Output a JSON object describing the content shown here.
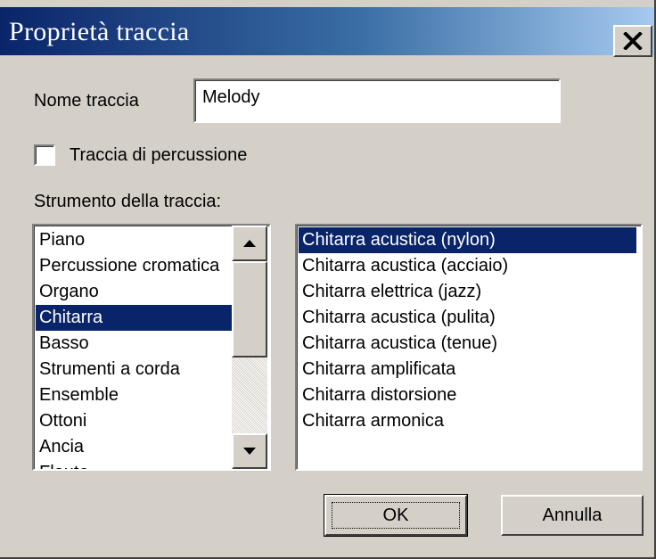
{
  "window": {
    "title": "Proprietà traccia",
    "close_icon": "close-icon"
  },
  "form": {
    "name_label": "Nome traccia",
    "name_value": "Melody",
    "percussion_label": "Traccia di percussione",
    "percussion_checked": false,
    "instrument_label": "Strumento della traccia:"
  },
  "categories": {
    "items": [
      "Piano",
      "Percussione cromatica",
      "Organo",
      "Chitarra",
      "Basso",
      "Strumenti a corda",
      "Ensemble",
      "Ottoni",
      "Ancia",
      "Flauto"
    ],
    "selected": "Chitarra"
  },
  "instruments": {
    "items": [
      "Chitarra acustica (nylon)",
      "Chitarra acustica (acciaio)",
      "Chitarra elettrica (jazz)",
      "Chitarra acustica (pulita)",
      "Chitarra acustica (tenue)",
      "Chitarra amplificata",
      "Chitarra distorsione",
      "Chitarra armonica"
    ],
    "selected": "Chitarra acustica (nylon)"
  },
  "buttons": {
    "ok_label": "OK",
    "cancel_label": "Annulla"
  }
}
